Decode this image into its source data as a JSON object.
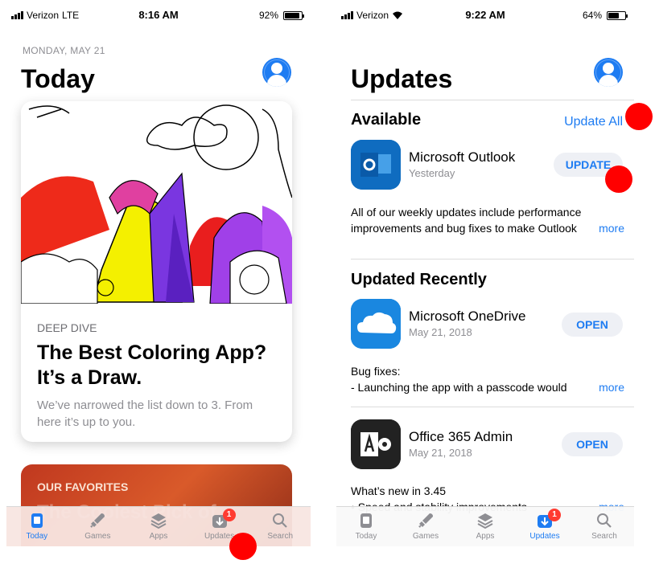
{
  "left_screen": {
    "status": {
      "carrier": "Verizon",
      "network": "LTE",
      "time": "8:16 AM",
      "battery": "92%",
      "battery_level": 0.92
    },
    "date": "MONDAY, MAY 21",
    "title": "Today",
    "card": {
      "eyebrow": "DEEP DIVE",
      "headline": "The Best Coloring App? It’s a Draw.",
      "subtitle": "We’ve narrowed the list down to 3. From here it’s up to you."
    },
    "card2": {
      "eyebrow": "OUR FAVORITES",
      "headline": "The Coolest Pick of"
    },
    "tabs": [
      {
        "label": "Today",
        "icon": "today-icon"
      },
      {
        "label": "Games",
        "icon": "rocket-icon"
      },
      {
        "label": "Apps",
        "icon": "layers-icon"
      },
      {
        "label": "Updates",
        "icon": "updates-icon",
        "badge": "1"
      },
      {
        "label": "Search",
        "icon": "search-icon"
      }
    ],
    "active_tab": "Today"
  },
  "right_screen": {
    "status": {
      "carrier": "Verizon",
      "network": "wifi",
      "time": "9:22 AM",
      "battery": "64%",
      "battery_level": 0.64
    },
    "title": "Updates",
    "available": {
      "heading": "Available",
      "update_all": "Update All",
      "app": {
        "name": "Microsoft Outlook",
        "date": "Yesterday",
        "button": "UPDATE",
        "notes": "All of our weekly updates include performance improvements and bug fixes to make Outlook",
        "more": "more"
      }
    },
    "recent": {
      "heading": "Updated Recently",
      "apps": [
        {
          "name": "Microsoft OneDrive",
          "date": "May 21, 2018",
          "button": "OPEN",
          "notes_line1": "Bug fixes:",
          "notes_line2": "- Launching the app with a passcode would",
          "more": "more"
        },
        {
          "name": "Office 365 Admin",
          "date": "May 21, 2018",
          "button": "OPEN",
          "notes_line1": "What’s new in 3.45",
          "notes_line2": "• Speed and stability improvements",
          "more": "more"
        }
      ]
    },
    "tabs": [
      {
        "label": "Today",
        "icon": "today-icon"
      },
      {
        "label": "Games",
        "icon": "rocket-icon"
      },
      {
        "label": "Apps",
        "icon": "layers-icon"
      },
      {
        "label": "Updates",
        "icon": "updates-icon",
        "badge": "1"
      },
      {
        "label": "Search",
        "icon": "search-icon"
      }
    ],
    "active_tab": "Updates"
  },
  "colors": {
    "accent": "#1e7cf2",
    "badge": "#ff3b30",
    "marker": "#ff0000"
  }
}
